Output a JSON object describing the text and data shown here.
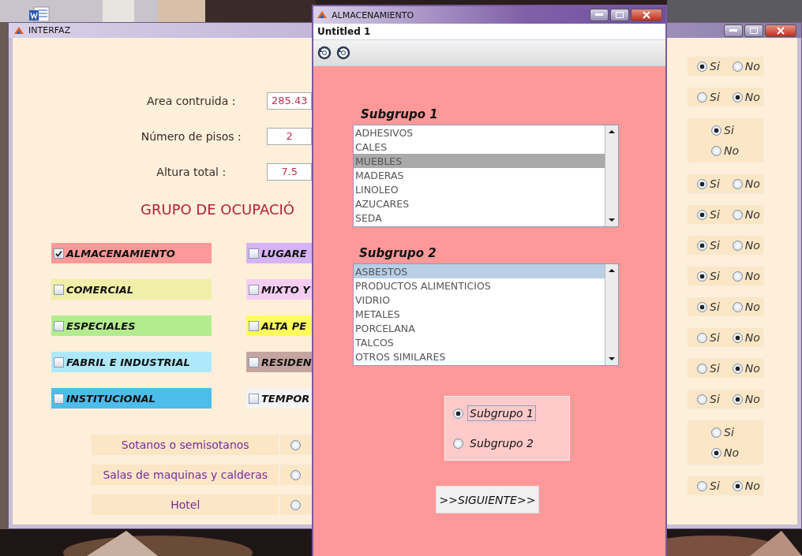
{
  "main_window": {
    "title": "INTERFAZ",
    "fields": [
      {
        "label": "Area contruida :",
        "value": "285.43"
      },
      {
        "label": "Número de pisos :",
        "value": "2"
      },
      {
        "label": "Altura total :",
        "value": "7.5"
      }
    ],
    "heading": "GRUPO DE OCUPACIÓ",
    "groups": [
      {
        "label": "ALMACENAMIENTO",
        "checked": true,
        "color": "#ff9999"
      },
      {
        "label": "LUGARE",
        "checked": false,
        "color": "#d5b3f5"
      },
      {
        "label": "COMERCIAL",
        "checked": false,
        "color": "#f0eea8"
      },
      {
        "label": "MIXTO Y",
        "checked": false,
        "color": "#f6cdf2"
      },
      {
        "label": "ESPECIALES",
        "checked": false,
        "color": "#b3ec8f"
      },
      {
        "label": "ALTA PE",
        "checked": false,
        "color": "#fefe5a"
      },
      {
        "label": "FABRIL E INDUSTRIAL",
        "checked": false,
        "color": "#aee9fb"
      },
      {
        "label": "RESIDEN",
        "checked": false,
        "color": "#c4a59f"
      },
      {
        "label": "INSTITUCIONAL",
        "checked": false,
        "color": "#4dbdec"
      },
      {
        "label": "TEMPOR",
        "checked": false,
        "color": "#f4f4f4"
      }
    ],
    "questions": [
      {
        "label": "Sotanos o semisotanos",
        "selected": false
      },
      {
        "label": "Salas de maquinas y calderas",
        "selected": false
      },
      {
        "label": "Hotel",
        "selected": false
      }
    ],
    "answers": [
      {
        "kind": "row",
        "options": [
          {
            "label": "Si",
            "selected": true
          },
          {
            "label": "No",
            "selected": false
          }
        ]
      },
      {
        "kind": "row",
        "options": [
          {
            "label": "Si",
            "selected": false
          },
          {
            "label": "No",
            "selected": true
          }
        ]
      },
      {
        "kind": "stack",
        "options": [
          {
            "label": "Si",
            "selected": true
          },
          {
            "label": "No",
            "selected": false
          }
        ]
      },
      {
        "kind": "row",
        "options": [
          {
            "label": "Si",
            "selected": true
          },
          {
            "label": "No",
            "selected": false
          }
        ]
      },
      {
        "kind": "row",
        "options": [
          {
            "label": "Si",
            "selected": true
          },
          {
            "label": "No",
            "selected": false
          }
        ]
      },
      {
        "kind": "row",
        "options": [
          {
            "label": "Si",
            "selected": true
          },
          {
            "label": "No",
            "selected": false
          }
        ]
      },
      {
        "kind": "row",
        "options": [
          {
            "label": "Si",
            "selected": true
          },
          {
            "label": "No",
            "selected": false
          }
        ]
      },
      {
        "kind": "row",
        "options": [
          {
            "label": "Si",
            "selected": true
          },
          {
            "label": "No",
            "selected": false
          }
        ]
      },
      {
        "kind": "row",
        "options": [
          {
            "label": "Si",
            "selected": false
          },
          {
            "label": "No",
            "selected": true
          }
        ]
      },
      {
        "kind": "row",
        "options": [
          {
            "label": "Si",
            "selected": false
          },
          {
            "label": "No",
            "selected": true
          }
        ]
      },
      {
        "kind": "row",
        "options": [
          {
            "label": "Si",
            "selected": false
          },
          {
            "label": "No",
            "selected": true
          }
        ]
      },
      {
        "kind": "stack",
        "options": [
          {
            "label": "Si",
            "selected": false
          },
          {
            "label": "No",
            "selected": true
          }
        ]
      },
      {
        "kind": "row",
        "options": [
          {
            "label": "Si",
            "selected": false
          },
          {
            "label": "No",
            "selected": true
          }
        ]
      }
    ]
  },
  "dialog": {
    "title": "ALMACENAMIENTO",
    "menu": "Untitled 1",
    "lists": [
      {
        "label": "Subgrupo 1",
        "items": [
          {
            "text": "ADHESIVOS",
            "selected": false
          },
          {
            "text": "CALES",
            "selected": false
          },
          {
            "text": "MUEBLES",
            "selected": true
          },
          {
            "text": "MADERAS",
            "selected": false
          },
          {
            "text": "LINOLEO",
            "selected": false
          },
          {
            "text": "AZUCARES",
            "selected": false
          },
          {
            "text": "SEDA",
            "selected": false
          }
        ]
      },
      {
        "label": "Subgrupo 2",
        "items": [
          {
            "text": "ASBESTOS",
            "selected": true
          },
          {
            "text": "PRODUCTOS ALIMENTICIOS",
            "selected": false
          },
          {
            "text": "VIDRIO",
            "selected": false
          },
          {
            "text": "METALES",
            "selected": false
          },
          {
            "text": "PORCELANA",
            "selected": false
          },
          {
            "text": "TALCOS",
            "selected": false
          },
          {
            "text": "OTROS SIMILARES",
            "selected": false
          }
        ]
      }
    ],
    "choices": [
      {
        "label": "Subgrupo 1",
        "selected": true
      },
      {
        "label": "Subgrupo 2",
        "selected": false
      }
    ],
    "button": ">>SIGUIENTE>>"
  }
}
